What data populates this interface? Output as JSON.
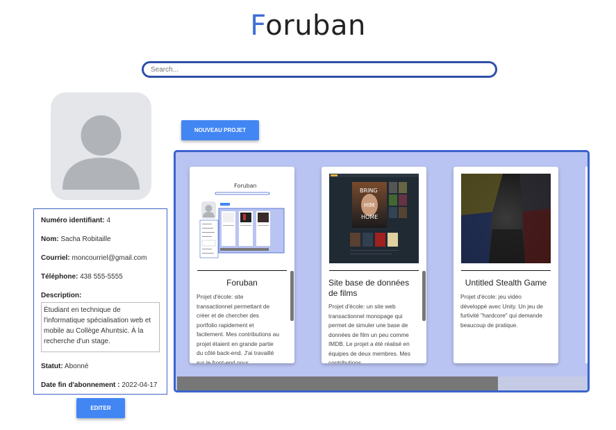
{
  "app": {
    "logo_first": "F",
    "logo_rest": "oruban"
  },
  "search": {
    "placeholder": "Search..."
  },
  "profile": {
    "id_label": "Numéro identifiant:",
    "id_value": "4",
    "name_label": "Nom:",
    "name_value": "Sacha Robitaille",
    "email_label": "Courriel:",
    "email_value": "moncourriel@gmail.com",
    "phone_label": "Téléphone:",
    "phone_value": "438 555-5555",
    "description_label": "Description:",
    "description_value": "Étudiant en technique de l'informatique spécialisation web et mobile au Collège Ahuntsic. À la recherche d'un stage.",
    "status_label": "Statut:",
    "status_value": "Abonné",
    "sub_end_label": "Date fin d'abonnement :",
    "sub_end_value": "2022-04-17",
    "edit_button": "EDITER"
  },
  "projects": {
    "new_button": "NOUVEAU PROJET",
    "cards": [
      {
        "title": "Foruban",
        "description": "Projet d'école: site transactionnel permettant de créer et de chercher des portfolio rapidement et facilement. Mes contributions au projet étaient en grande partie du côté back-end. J'ai travaillé sur le front-end pour",
        "thumb_title": "Foruban"
      },
      {
        "title": "Site base de données de films",
        "description": "Projet d'école: un site web transactionnel monopage qui permet de simuler une base de données de film un peu comme IMDB. Le projet a été réalisé en équipes de deux membres. Mes contributions",
        "poster_words": [
          "BRING",
          "HIM",
          "HOME"
        ]
      },
      {
        "title": "Untitled Stealth Game",
        "description": "Projet d'école: jeu vidéo développé avec Unity. Un jeu de furtivité \"hardcore\" qui demande beaucoup de pratique."
      }
    ]
  },
  "colors": {
    "accent": "#4286f4",
    "panel": "#b9c4f2",
    "border": "#3a63cd",
    "logo_accent": "#3d6fd6"
  }
}
